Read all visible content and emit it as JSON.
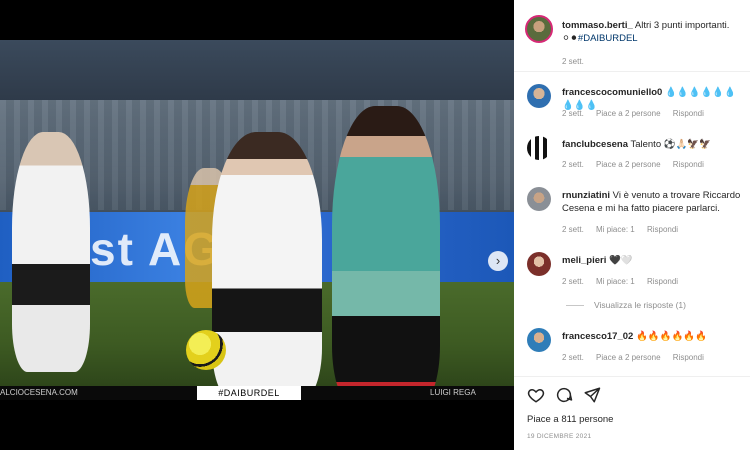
{
  "photo": {
    "board_text": "st   AGENZ",
    "footer_left": "ALCIOCESENA.COM",
    "footer_tag": "#DAIBURDEL",
    "footer_right": "LUIGI REGA",
    "next_icon": "chevron-right-icon"
  },
  "post": {
    "username": "tommaso.berti_",
    "caption_text": "Altri 3 punti importanti. ",
    "caption_symbols": "⚪⚫",
    "caption_hashtag": "#DAIBURDEL",
    "time": "2 sett."
  },
  "comments": [
    {
      "user": "francescocomuniello0",
      "text": "💧💧💧💧💧💧💧💧💧",
      "time": "2 sett.",
      "likes": "Piace a 2 persone",
      "reply": "Rispondi"
    },
    {
      "user": "fanclubcesena",
      "text": "Talento ⚽🙏🏻🦅🦅",
      "time": "2 sett.",
      "likes": "Piace a 2 persone",
      "reply": "Rispondi"
    },
    {
      "user": "rnunziatini",
      "text": "Vi è venuto a trovare Riccardo Cesena e mi ha fatto piacere parlarci.",
      "time": "2 sett.",
      "likes": "Mi piace: 1",
      "reply": "Rispondi"
    },
    {
      "user": "meli_pieri",
      "text": "🖤🤍",
      "time": "2 sett.",
      "likes": "Mi piace: 1",
      "reply": "Rispondi"
    },
    {
      "user": "francesco17_02",
      "text": "🔥🔥🔥🔥🔥🔥",
      "time": "2 sett.",
      "likes": "Piace a 2 persone",
      "reply": "Rispondi"
    }
  ],
  "view_replies": "Visualizza le risposte (1)",
  "actions": {
    "like_icon": "heart-icon",
    "comment_icon": "comment-icon",
    "share_icon": "send-icon",
    "likes_count": "Piace a 811 persone",
    "date": "19 DICEMBRE 2021"
  }
}
